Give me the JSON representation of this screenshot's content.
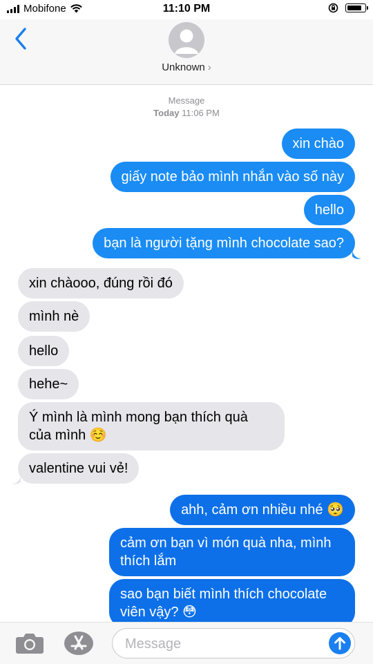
{
  "status_bar": {
    "carrier": "Mobifone",
    "time": "11:10 PM",
    "battery_level": 0.85
  },
  "header": {
    "contact_name": "Unknown",
    "contact_chevron": "›"
  },
  "conversation": {
    "service_label": "Message",
    "timestamp_day": "Today",
    "timestamp_time": "11:06 PM",
    "messages": [
      {
        "from": "me",
        "text": "xin chào"
      },
      {
        "from": "me",
        "text": "giấy note bảo mình nhắn vào số này"
      },
      {
        "from": "me",
        "text": "hello"
      },
      {
        "from": "me",
        "text": "bạn là người tặng mình chocolate sao?"
      },
      {
        "from": "them",
        "text": "xin chàooo, đúng rồi đó"
      },
      {
        "from": "them",
        "text": "mình nè"
      },
      {
        "from": "them",
        "text": "hello"
      },
      {
        "from": "them",
        "text": "hehe~"
      },
      {
        "from": "them",
        "text": "Ý mình là mình mong bạn thích quà của mình ☺️"
      },
      {
        "from": "them",
        "text": "valentine vui vẻ!"
      },
      {
        "from": "me",
        "text": "ahh, cảm ơn nhiều nhé 🥺"
      },
      {
        "from": "me",
        "text": "cảm ơn bạn vì món quà nha, mình thích lắm"
      },
      {
        "from": "me",
        "text": "sao bạn biết mình thích chocolate viên vậy? 😳"
      }
    ]
  },
  "composer": {
    "placeholder": "Message"
  },
  "icons": {
    "back": "chevron-left-icon",
    "wifi": "wifi-icon",
    "lock": "orientation-lock-icon",
    "camera": "camera-icon",
    "apps": "app-store-icon",
    "send": "send-arrow-icon"
  },
  "colors": {
    "imessage_blue": "#1a8cf4",
    "received_gray": "#e5e5ea",
    "accent": "#1a7ff0"
  }
}
